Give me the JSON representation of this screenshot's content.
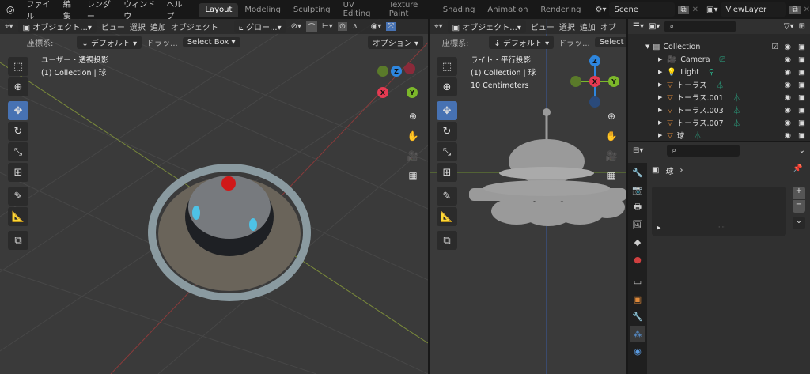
{
  "topbar": {
    "menus": [
      "ファイル",
      "編集",
      "レンダー",
      "ウィンドウ",
      "ヘルプ"
    ],
    "workspaces": [
      "Layout",
      "Modeling",
      "Sculpting",
      "UV Editing",
      "Texture Paint",
      "Shading",
      "Animation",
      "Rendering"
    ],
    "active_workspace": "Layout",
    "scene": "Scene",
    "view_layer": "ViewLayer"
  },
  "left_viewport": {
    "mode": "オブジェクト...",
    "menus": [
      "ビュー",
      "選択",
      "追加",
      "オブジェクト"
    ],
    "transform": "グロー...",
    "coord_label": "座標系:",
    "coord_value": "デフォルト",
    "drag_label": "ドラッ...",
    "drag_value": "Select Box",
    "options": "オプション",
    "view_name": "ユーザー・透視投影",
    "collection_info": "(1) Collection | 球"
  },
  "right_viewport": {
    "mode": "オブジェクト...",
    "menus": [
      "ビュー",
      "選択",
      "追加",
      "オブ"
    ],
    "coord_label": "座標系:",
    "coord_value": "デフォルト",
    "drag_label": "ドラッ...",
    "drag_value": "Select",
    "view_name": "ライト・平行投影",
    "collection_info": "(1) Collection | 球",
    "scale": "10 Centimeters"
  },
  "gizmo": {
    "x": "X",
    "y": "Y",
    "z": "Z",
    "colors": {
      "x": "#e53a52",
      "y": "#7cb82a",
      "z": "#2e86de"
    }
  },
  "outliner": {
    "collection": "Collection",
    "items": [
      {
        "name": "Camera",
        "icon": "camera-icon"
      },
      {
        "name": "Light",
        "icon": "light-icon"
      },
      {
        "name": "トーラス",
        "icon": "mesh-icon"
      },
      {
        "name": "トーラス.001",
        "icon": "mesh-icon"
      },
      {
        "name": "トーラス.003",
        "icon": "mesh-icon"
      },
      {
        "name": "トーラス.007",
        "icon": "mesh-icon"
      },
      {
        "name": "球",
        "icon": "mesh-icon"
      }
    ]
  },
  "properties": {
    "object_name": "球",
    "add": "+",
    "remove": "−"
  }
}
